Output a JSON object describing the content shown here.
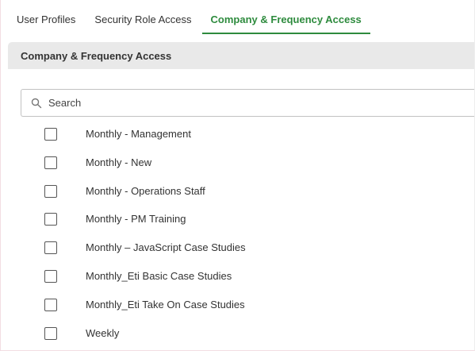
{
  "tabs": [
    {
      "label": "User Profiles"
    },
    {
      "label": "Security Role Access"
    },
    {
      "label": "Company & Frequency Access"
    }
  ],
  "active_tab": "Company & Frequency Access",
  "accent_color": "#2e8b3e",
  "panel": {
    "title": "Company & Frequency Access"
  },
  "search": {
    "placeholder": "Search",
    "value": "",
    "icon": "search-icon"
  },
  "items": [
    {
      "label": "Monthly - Management",
      "checked": false
    },
    {
      "label": "Monthly - New",
      "checked": false
    },
    {
      "label": "Monthly - Operations Staff",
      "checked": false
    },
    {
      "label": "Monthly - PM Training",
      "checked": false
    },
    {
      "label": "Monthly – JavaScript Case Studies",
      "checked": false
    },
    {
      "label": "Monthly_Eti Basic Case Studies",
      "checked": false
    },
    {
      "label": "Monthly_Eti Take On Case Studies",
      "checked": false
    },
    {
      "label": "Weekly",
      "checked": false
    }
  ]
}
